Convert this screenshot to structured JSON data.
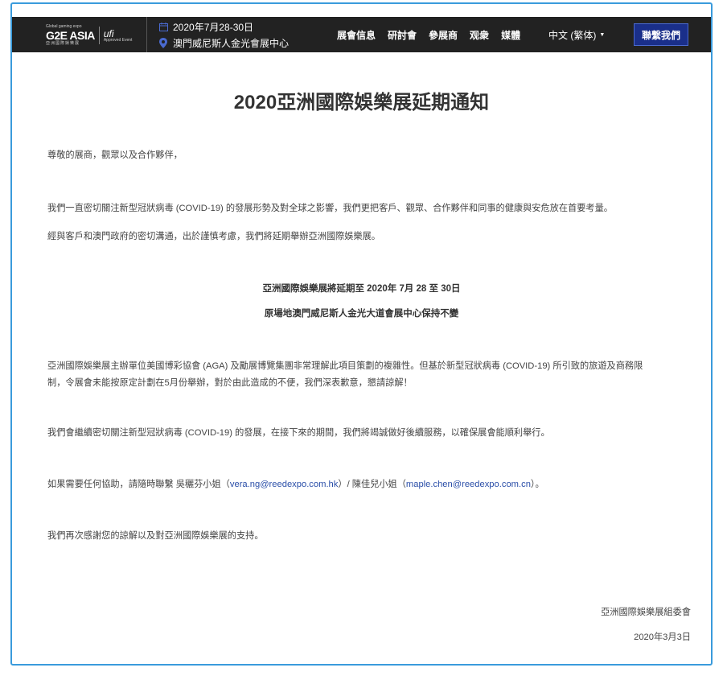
{
  "header": {
    "logo": {
      "tagline": "Global gaming expo",
      "name": "G2E ASIA",
      "sub": "亞洲國際娛樂展",
      "ufi": "ufi",
      "ufi_sub": "Approved Event"
    },
    "event_date": "2020年7月28-30日",
    "event_venue": "澳門威尼斯人金光會展中心",
    "nav": [
      "展會信息",
      "研討會",
      "參展商",
      "观衆",
      "媒體"
    ],
    "language": "中文 (繁体)",
    "contact_button": "聯繫我們"
  },
  "notice": {
    "title": "2020亞洲國際娛樂展延期通知",
    "greeting": "尊敬的展商，觀眾以及合作夥伴，",
    "paragraph1": "我們一直密切關注新型冠狀病毒 (COVID-19) 的發展形勢及對全球之影響，我們更把客戶、觀眾、合作夥伴和同事的健康與安危放在首要考量。",
    "paragraph2": "經與客戶和澳門政府的密切溝通，出於謹慎考慮，我們將延期舉辦亞洲國際娛樂展。",
    "highlight1": "亞洲國際娛樂展將延期至 2020年 7月 28 至 30日",
    "highlight2": "原場地澳門威尼斯人金光大道會展中心保持不變",
    "paragraph3_line1": "亞洲國際娛樂展主辦單位美國博彩協會 (AGA) 及勵展博覽集團非常理解此項目策劃的複雜性。但基於新型冠狀病毒 (COVID-19) 所引致的旅遊及商務限",
    "paragraph3_line2": "制，令展會未能按原定計劃在5月份舉辦，對於由此造成的不便，我們深表歉意，懇請諒解！",
    "paragraph4": "我們會繼續密切關注新型冠狀病毒 (COVID-19) 的發展，在接下來的期間，我們將竭誠做好後續服務，以確保展會能順利舉行。",
    "contact_prefix": "如果需要任何協助，請隨時聯繫 吳穲芬小姐（",
    "contact_email1": "vera.ng@reedexpo.com.hk",
    "contact_middle": "）/ 陳佳兒小姐（",
    "contact_email2": "maple.chen@reedexpo.com.cn",
    "contact_suffix": "）。",
    "paragraph5": "我們再次感謝您的諒解以及對亞洲國際娛樂展的支持。",
    "signature": "亞洲國際娛樂展組委會",
    "date": "2020年3月3日"
  },
  "colors": {
    "header_bg": "#222222",
    "button_bg": "#1a2f8a",
    "frame_border": "#3a9bdc",
    "link": "#2a4ea8"
  }
}
